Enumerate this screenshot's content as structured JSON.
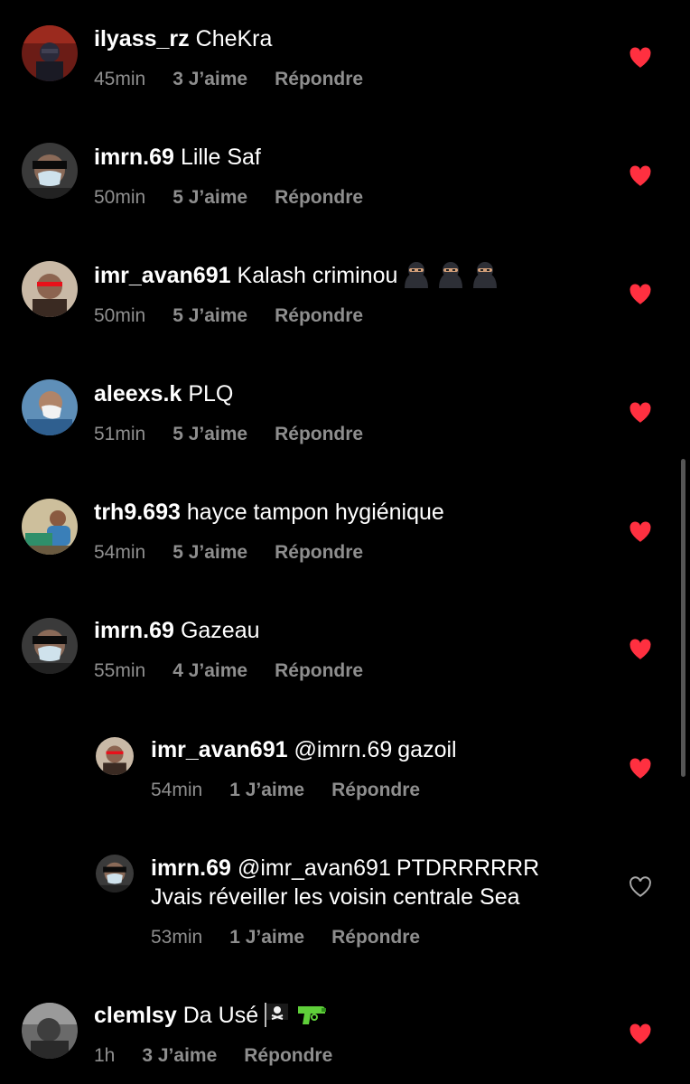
{
  "colors": {
    "background": "#000000",
    "text": "#ffffff",
    "meta": "#8e8e8e",
    "heart_liked": "#ff3040",
    "heart_outline": "#a8a8a8"
  },
  "comments": [
    {
      "username": "ilyass_rz",
      "text": "CheKra",
      "time": "45min",
      "likes": "3 J’aime",
      "reply": "Répondre",
      "liked": true,
      "avatar_icon": "user-avatar-photo"
    },
    {
      "username": "imrn.69",
      "text": "Lille Saf",
      "time": "50min",
      "likes": "5 J’aime",
      "reply": "Répondre",
      "liked": true,
      "avatar_icon": "user-avatar-photo"
    },
    {
      "username": "imr_avan691",
      "text": "Kalash criminou",
      "emojis": [
        "ninja-emoji",
        "ninja-emoji",
        "ninja-emoji"
      ],
      "time": "50min",
      "likes": "5 J’aime",
      "reply": "Répondre",
      "liked": true,
      "avatar_icon": "user-avatar-photo"
    },
    {
      "username": "aleexs.k",
      "text": "PLQ",
      "time": "51min",
      "likes": "5 J’aime",
      "reply": "Répondre",
      "liked": true,
      "avatar_icon": "user-avatar-photo"
    },
    {
      "username": "trh9.693",
      "text": "hayce tampon hygiénique",
      "time": "54min",
      "likes": "5 J’aime",
      "reply": "Répondre",
      "liked": true,
      "avatar_icon": "user-avatar-photo"
    },
    {
      "username": "imrn.69",
      "text": "Gazeau",
      "time": "55min",
      "likes": "4 J’aime",
      "reply": "Répondre",
      "liked": true,
      "avatar_icon": "user-avatar-photo"
    },
    {
      "username": "imr_avan691",
      "mention": "@imrn.69",
      "text": "gazoil",
      "time": "54min",
      "likes": "1 J’aime",
      "reply": "Répondre",
      "liked": true,
      "avatar_icon": "user-avatar-photo"
    },
    {
      "username": "imrn.69",
      "mention": "@imr_avan691",
      "text": "PTDRRRRRR\nJvais réveiller les voisin centrale Sea",
      "time": "53min",
      "likes": "1 J’aime",
      "reply": "Répondre",
      "liked": false,
      "avatar_icon": "user-avatar-photo"
    },
    {
      "username": "clemlsy",
      "text": "Da Usé",
      "emojis": [
        "pirate-flag-emoji",
        "water-pistol-emoji"
      ],
      "time": "1h",
      "likes": "3 J’aime",
      "reply": "Répondre",
      "liked": true,
      "avatar_icon": "user-avatar-photo"
    }
  ]
}
